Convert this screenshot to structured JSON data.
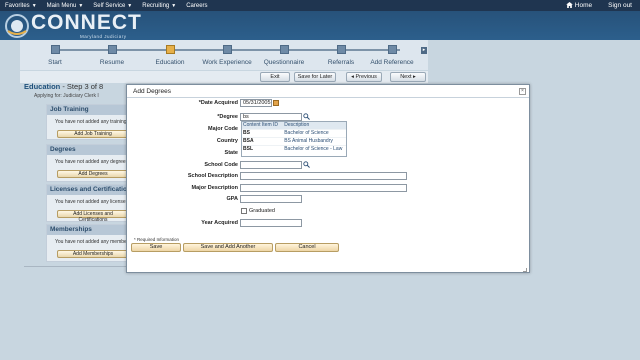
{
  "topnav": {
    "items": [
      "Favorites",
      "Main Menu",
      "Self Service",
      "Recruiting",
      "Careers"
    ],
    "home_label": "Home",
    "signout_label": "Sign out"
  },
  "banner": {
    "brand": "CONNECT",
    "subtitle": "Maryland Judiciary"
  },
  "steps": [
    {
      "label": "Start",
      "active": false
    },
    {
      "label": "Resume",
      "active": false
    },
    {
      "label": "Education",
      "active": true
    },
    {
      "label": "Work Experience",
      "active": false
    },
    {
      "label": "Questionnaire",
      "active": false
    },
    {
      "label": "Referrals",
      "active": false
    },
    {
      "label": "Add Reference",
      "active": false
    }
  ],
  "toolbar": {
    "exit": "Exit",
    "save_for_later": "Save for Later",
    "previous": "Previous",
    "next": "Next"
  },
  "page": {
    "title": "Education",
    "step_of": " - Step 3 of 8",
    "applying": "Applying for: Judiciary Clerk I"
  },
  "sections": [
    {
      "title": "Job Training",
      "message": "You have not added any training.",
      "button": "Add Job Training"
    },
    {
      "title": "Degrees",
      "message": "You have not added any degrees.",
      "button": "Add Degrees"
    },
    {
      "title": "Licenses and Certifications",
      "message": "You have not added any licenses.",
      "button": "Add Licenses and Certifications"
    },
    {
      "title": "Memberships",
      "message": "You have not added any memberships.",
      "button": "Add Memberships"
    }
  ],
  "modal": {
    "title": "Add Degrees",
    "labels": {
      "date_acquired": "*Date Acquired",
      "degree": "*Degree",
      "major_code": "Major Code",
      "country": "Country",
      "state": "State",
      "school_code": "School Code",
      "school_description": "School Description",
      "major_description": "Major Description",
      "gpa": "GPA",
      "graduated": "Graduated",
      "year_acquired": "Year Acquired"
    },
    "values": {
      "date_acquired": "05/31/2005",
      "degree": "bs"
    },
    "dropdown": {
      "headers": [
        "Content Item ID",
        "Description"
      ],
      "rows": [
        {
          "id": "BS",
          "desc": "Bachelor of Science"
        },
        {
          "id": "BSA",
          "desc": "BS Animal Husbandry"
        },
        {
          "id": "BSL",
          "desc": "Bachelor of Science - Law"
        }
      ]
    },
    "required_note": "* Required Information",
    "buttons": {
      "save": "Save",
      "save_add": "Save and Add Another",
      "cancel": "Cancel"
    }
  },
  "colors": {
    "topnav": "#1f3550",
    "banner": "#2c5f8c",
    "active_step": "#e6b04a",
    "section_header": "#b7c7d6"
  }
}
